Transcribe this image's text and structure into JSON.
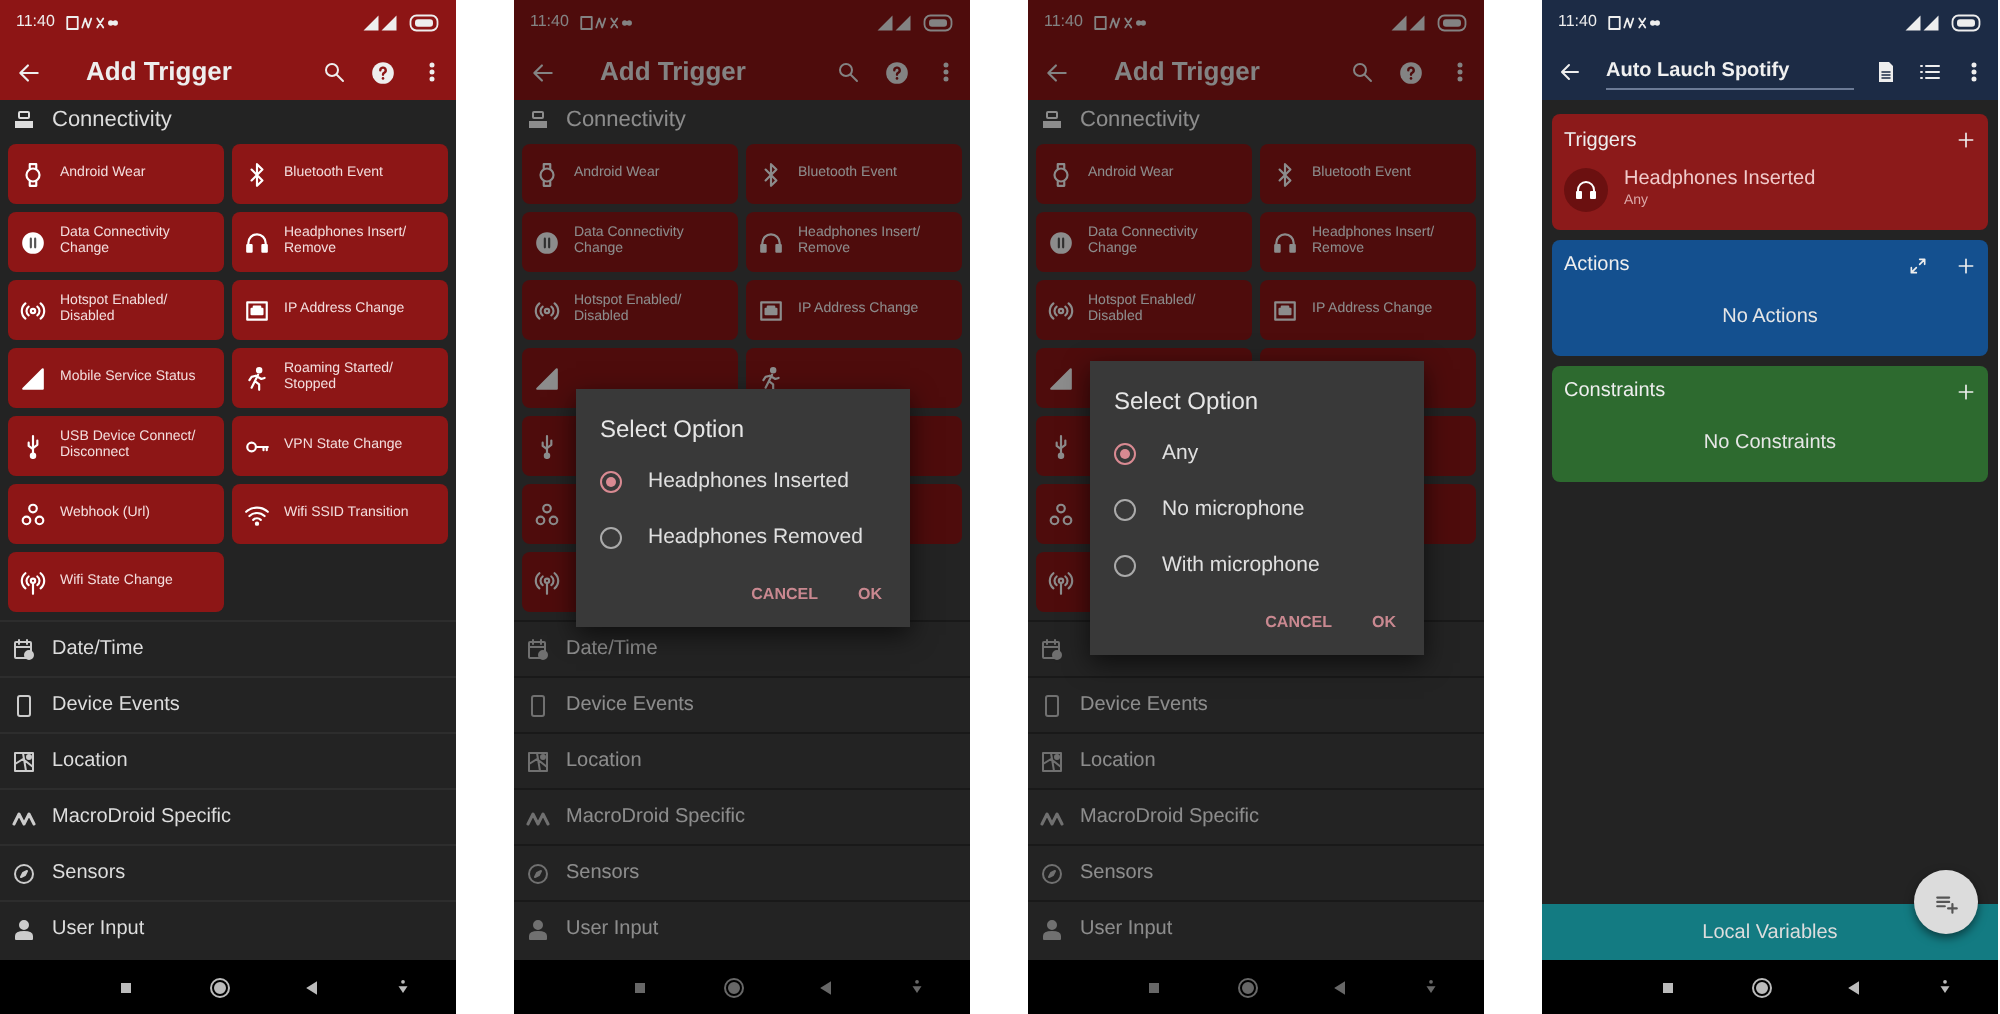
{
  "screens": [
    {
      "kind": "trigger_list",
      "dimmed": false,
      "status_bar": {
        "time": "11:40"
      },
      "app_bar": {
        "title": "Add Trigger"
      },
      "section": {
        "title": "Connectivity"
      },
      "tiles": [
        {
          "label": "Android Wear"
        },
        {
          "label": "Bluetooth Event"
        },
        {
          "label": "Data Connectivity Change"
        },
        {
          "label": "Headphones Insert/ Remove"
        },
        {
          "label": "Hotspot Enabled/ Disabled"
        },
        {
          "label": "IP Address Change"
        },
        {
          "label": "Mobile Service Status"
        },
        {
          "label": "Roaming Started/ Stopped"
        },
        {
          "label": "USB Device Connect/ Disconnect"
        },
        {
          "label": "VPN State Change"
        },
        {
          "label": "Webhook (Url)"
        },
        {
          "label": "Wifi SSID Transition"
        },
        {
          "label": "Wifi State Change"
        }
      ],
      "categories": [
        {
          "label": "Date/Time"
        },
        {
          "label": "Device Events"
        },
        {
          "label": "Location"
        },
        {
          "label": "MacroDroid Specific"
        },
        {
          "label": "Sensors"
        },
        {
          "label": "User Input"
        }
      ]
    },
    {
      "kind": "trigger_list",
      "dimmed": true,
      "status_bar": {
        "time": "11:40"
      },
      "app_bar": {
        "title": "Add Trigger"
      },
      "section": {
        "title": "Connectivity"
      },
      "tiles": [
        {
          "kind": "labeled",
          "label": "Android Wear"
        },
        {
          "kind": "labeled",
          "label": "Bluetooth Event"
        },
        {
          "kind": "labeled",
          "label": "Data Connectivity Change"
        },
        {
          "kind": "labeled",
          "label": "Headphones Insert/ Remove"
        },
        {
          "kind": "labeled",
          "label": "Hotspot Enabled/ Disabled"
        },
        {
          "kind": "labeled",
          "label": "IP Address Change"
        },
        {
          "kind": "covered"
        },
        {
          "kind": "covered"
        },
        {
          "kind": "covered"
        },
        {
          "kind": "hidden"
        },
        {
          "kind": "covered"
        },
        {
          "kind": "hidden"
        },
        {
          "kind": "covered"
        }
      ],
      "categories": [
        {
          "label": "Date/Time"
        },
        {
          "label": "Device Events"
        },
        {
          "label": "Location"
        },
        {
          "label": "MacroDroid Specific"
        },
        {
          "label": "Sensors"
        },
        {
          "label": "User Input"
        }
      ],
      "dialog": {
        "title": "Select Option",
        "options": [
          {
            "label": "Headphones Inserted",
            "selected": true
          },
          {
            "label": "Headphones Removed",
            "selected": false
          }
        ],
        "buttons": [
          "CANCEL",
          "OK"
        ]
      }
    },
    {
      "kind": "trigger_list",
      "dimmed": true,
      "status_bar": {
        "time": "11:40"
      },
      "app_bar": {
        "title": "Add Trigger"
      },
      "section": {
        "title": "Connectivity"
      },
      "tiles": [
        {
          "kind": "labeled",
          "label": "Android Wear"
        },
        {
          "kind": "labeled",
          "label": "Bluetooth Event"
        },
        {
          "kind": "labeled",
          "label": "Data Connectivity Change"
        },
        {
          "kind": "labeled",
          "label": "Headphones Insert/ Remove"
        },
        {
          "kind": "labeled",
          "label": "Hotspot Enabled/ Disabled"
        },
        {
          "kind": "labeled",
          "label": "IP Address Change"
        },
        {
          "kind": "covered"
        },
        {
          "kind": "hidden"
        },
        {
          "kind": "covered"
        },
        {
          "kind": "hidden"
        },
        {
          "kind": "covered"
        },
        {
          "kind": "hidden"
        },
        {
          "kind": "covered"
        }
      ],
      "categories": [
        {
          "kind": "covered"
        },
        {
          "kind": "labeled",
          "label": "Device Events"
        },
        {
          "kind": "labeled",
          "label": "Location"
        },
        {
          "kind": "labeled",
          "label": "MacroDroid Specific"
        },
        {
          "kind": "labeled",
          "label": "Sensors"
        },
        {
          "kind": "labeled",
          "label": "User Input"
        }
      ],
      "dialog": {
        "title": "Select Option",
        "options": [
          {
            "label": "Any",
            "selected": true
          },
          {
            "label": "No microphone",
            "selected": false
          },
          {
            "label": "With microphone",
            "selected": false
          }
        ],
        "buttons": [
          "CANCEL",
          "OK"
        ]
      }
    },
    {
      "kind": "macro_editor",
      "status_bar": {
        "time": "11:40"
      },
      "app_bar": {
        "title": "Auto Lauch Spotify"
      },
      "sections": [
        {
          "kind": "triggers",
          "title": "Triggers",
          "items": [
            {
              "title": "Headphones Inserted",
              "subtitle": "Any"
            }
          ]
        },
        {
          "kind": "actions",
          "title": "Actions",
          "empty_text": "No Actions"
        },
        {
          "kind": "constraints",
          "title": "Constraints",
          "empty_text": "No Constraints"
        }
      ],
      "bottom_bar": {
        "label": "Local Variables"
      }
    }
  ]
}
